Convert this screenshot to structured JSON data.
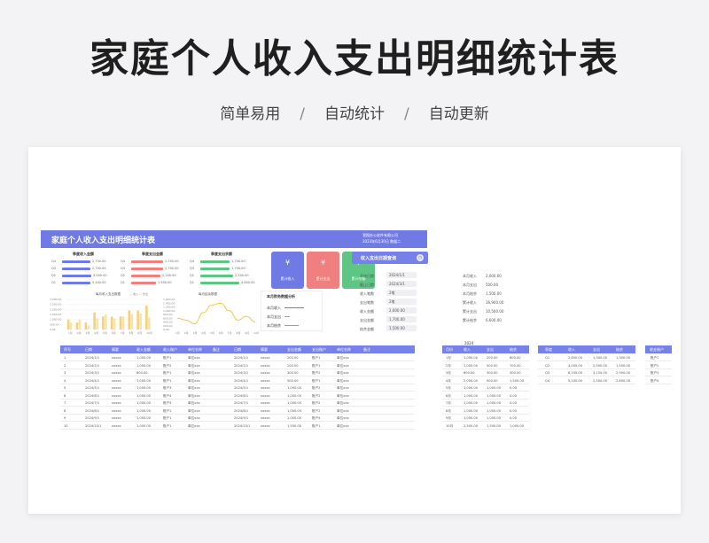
{
  "hero": {
    "title": "家庭个人收入支出明细统计表",
    "features": [
      "简单易用",
      "自动统计",
      "自动更新"
    ],
    "separator": "/"
  },
  "colors": {
    "primary": "#6f7ae4",
    "blue_tile": "#6f7ae4",
    "red_tile": "#f07f7f",
    "green_tile": "#5fc584",
    "bar_blue": "#6f7ae4",
    "bar_red": "#f07f7f",
    "bar_green": "#5fc584",
    "bar_yellow": "#f5d27a",
    "line_yellow": "#f3c646"
  },
  "sheet": {
    "title": "家庭个人收入支出明细统计表",
    "company": "我图办公软件有限公司",
    "date": "2023年6月30日    数据二",
    "quarter_income": {
      "title": "季度收入金额",
      "labels": [
        "Q4",
        "Q3",
        "Q2",
        "Q1"
      ],
      "values": [
        "2,700.00",
        "2,700.00",
        "5,000.00",
        "5,400.00"
      ],
      "fractions": [
        0.54,
        0.54,
        0.55,
        0.53
      ]
    },
    "quarter_expense": {
      "title": "季度支出金额",
      "labels": [
        "Q4",
        "Q3",
        "Q2",
        "Q1"
      ],
      "values": [
        "2,700.00",
        "2,700.00",
        "2,200.00",
        "1,500.00"
      ],
      "fractions": [
        0.6,
        0.6,
        0.55,
        0.47
      ]
    },
    "quarter_balance": {
      "title": "季度支出余额",
      "labels": [
        "Q4",
        "Q3",
        "Q2",
        "Q1"
      ],
      "values": [
        "1,700.00",
        "1,700.00",
        "2,200.00",
        "4,800.00"
      ],
      "fractions": [
        0.55,
        0.55,
        0.62,
        0.74
      ]
    },
    "tiles": [
      {
        "icon": "¥",
        "label": "累计收入"
      },
      {
        "icon": "¥",
        "label": "累计支出"
      },
      {
        "icon": "¥",
        "label": "累计余额"
      }
    ],
    "monthly_chart": {
      "title": "每月收入支出数据",
      "legend": "— 收入  — 支出",
      "y_ticks": [
        "3,000.00",
        "2,500.00",
        "2,000.00",
        "1,500.00",
        "1,000.00",
        "500.00",
        "0.00"
      ],
      "months": [
        "1月",
        "2月",
        "3月",
        "4月",
        "5月",
        "6月",
        "7月",
        "8月",
        "9月",
        "10月"
      ],
      "values_a": [
        1000,
        700,
        700,
        1700,
        1300,
        1300,
        1300,
        1900,
        1900,
        2400
      ],
      "values_b": [
        700,
        1000,
        400,
        1100,
        1500,
        1100,
        1300,
        1500,
        1600,
        1200
      ]
    },
    "balance_chart": {
      "title": "每月结余数据",
      "y_ticks": [
        "1,600.00",
        "1,400.00",
        "1,200.00",
        "1,000.00",
        "800.00",
        "600.00",
        "400.00",
        "200.00",
        "0.00"
      ],
      "months": [
        "1月",
        "2月",
        "3月",
        "4月",
        "5月",
        "6月",
        "7月",
        "8月",
        "9月",
        "10月"
      ],
      "values": [
        600,
        500,
        300,
        900,
        1300,
        1400,
        1000,
        500,
        700,
        400
      ]
    },
    "month_panel": {
      "title": "本月财务数据分析",
      "rows": [
        "本月收入",
        "本月支出",
        "本月结余"
      ]
    },
    "query": {
      "title": "收入支出日期查询",
      "rows": [
        {
          "label": "开始日期",
          "value": "2024/1/1"
        },
        {
          "label": "截止日期",
          "value": "2024/3/1"
        },
        {
          "label": "收入笔数",
          "value": "2笔"
        },
        {
          "label": "支出笔数",
          "value": "2笔"
        },
        {
          "label": "收入金额",
          "value": "2,600.00"
        },
        {
          "label": "支出金额",
          "value": "1,700.00"
        },
        {
          "label": "结余金额",
          "value": "1,500.00"
        }
      ]
    },
    "summary": [
      {
        "label": "本月收入",
        "value": "2,000.00"
      },
      {
        "label": "本月支出",
        "value": "500.00"
      },
      {
        "label": "本月结余",
        "value": "1,500.00"
      },
      {
        "label": "累计收入",
        "value": "16,900.00"
      },
      {
        "label": "累计支出",
        "value": "10,500.00"
      },
      {
        "label": "累计结余",
        "value": "6,600.00"
      }
    ],
    "ledger_headers": [
      "序号",
      "日期",
      "摘要",
      "收入金额",
      "收入账户",
      "单位名称",
      "备注",
      "日期",
      "摘要",
      "支出金额",
      "支出账户",
      "单位名称",
      "备注"
    ],
    "ledger_rows": [
      [
        "1",
        "2024/1/1",
        "xxxxx",
        "1,000.00",
        "账户1",
        "单位xxx",
        "",
        "2024/1/1",
        "xxxxx",
        "200.00",
        "账户1",
        "单位xxx",
        ""
      ],
      [
        "2",
        "2024/2/1",
        "xxxxx",
        "1,000.00",
        "账户2",
        "单位xxx",
        "",
        "2024/2/1",
        "xxxxx",
        "200.00",
        "账户1",
        "单位xxx",
        ""
      ],
      [
        "3",
        "2024/3/1",
        "xxxxx",
        "600.00",
        "账户1",
        "单位xxx",
        "",
        "2024/3/1",
        "xxxxx",
        "300.00",
        "账户2",
        "单位xxx",
        ""
      ],
      [
        "4",
        "2024/4/1",
        "xxxxx",
        "1,000.00",
        "账户1",
        "单位xxx",
        "",
        "2024/4/1",
        "xxxxx",
        "500.00",
        "账户1",
        "单位xxx",
        ""
      ],
      [
        "5",
        "2024/5/1",
        "xxxxx",
        "1,000.00",
        "账户3",
        "单位xxx",
        "",
        "2024/5/1",
        "xxxxx",
        "1,000.00",
        "账户2",
        "单位xxx",
        ""
      ],
      [
        "6",
        "2024/6/1",
        "xxxxx",
        "1,000.00",
        "账户4",
        "单位xxx",
        "",
        "2024/6/1",
        "xxxxx",
        "1,000.00",
        "账户2",
        "单位xxx",
        ""
      ],
      [
        "7",
        "2024/7/1",
        "xxxxx",
        "1,000.00",
        "账户3",
        "单位xxx",
        "",
        "2024/7/1",
        "xxxxx",
        "1,000.00",
        "账户2",
        "单位xxx",
        ""
      ],
      [
        "8",
        "2024/8/1",
        "xxxxx",
        "1,000.00",
        "账户1",
        "单位xxx",
        "",
        "2024/8/1",
        "xxxxx",
        "1,000.00",
        "账户2",
        "单位xxx",
        ""
      ],
      [
        "9",
        "2024/9/1",
        "xxxxx",
        "1,000.00",
        "账户1",
        "单位xxx",
        "",
        "2024/9/1",
        "xxxxx",
        "1,000.00",
        "账户4",
        "单位xxx",
        ""
      ],
      [
        "10",
        "2024/10/1",
        "xxxxx",
        "1,000.00",
        "账户1",
        "单位xxx",
        "",
        "2024/10/1",
        "xxxxx",
        "1,500.00",
        "账户1",
        "单位xxx",
        ""
      ]
    ],
    "monthly_table": {
      "year": "2024",
      "headers": [
        "月份",
        "收入",
        "支出",
        "结余"
      ],
      "rows": [
        [
          "1月",
          "1,000.00",
          "200.00",
          "800.00"
        ],
        [
          "2月",
          "1,000.00",
          "500.00",
          "700.00"
        ],
        [
          "3月",
          "600.00",
          "300.00",
          "300.00"
        ],
        [
          "4月",
          "2,000.00",
          "500.00",
          "1,500.00"
        ],
        [
          "5月",
          "1,000.00",
          "1,000.00",
          "0.00"
        ],
        [
          "6月",
          "1,000.00",
          "1,000.00",
          "0.00"
        ],
        [
          "7月",
          "1,000.00",
          "1,000.00",
          "0.00"
        ],
        [
          "8月",
          "1,000.00",
          "1,000.00",
          "0.00"
        ],
        [
          "9月",
          "1,000.00",
          "1,000.00",
          "0.00"
        ],
        [
          "10月",
          "2,500.00",
          "1,500.00",
          "1,000.00"
        ]
      ]
    },
    "quarter_table": {
      "headers": [
        "季度",
        "收入",
        "支出",
        "结余"
      ],
      "rows": [
        [
          "Q1",
          "2,600.00",
          "1,300.00",
          "1,300.00"
        ],
        [
          "Q2",
          "4,000.00",
          "2,500.00",
          "1,500.00"
        ],
        [
          "Q3",
          "6,100.00",
          "3,150.00",
          "2,950.00"
        ],
        [
          "Q4",
          "5,100.00",
          "2,500.00",
          "2,600.00"
        ]
      ]
    },
    "account_table": {
      "header": "收支账户",
      "rows": [
        "账户1",
        "账户2",
        "账户3",
        "账户4"
      ]
    }
  }
}
